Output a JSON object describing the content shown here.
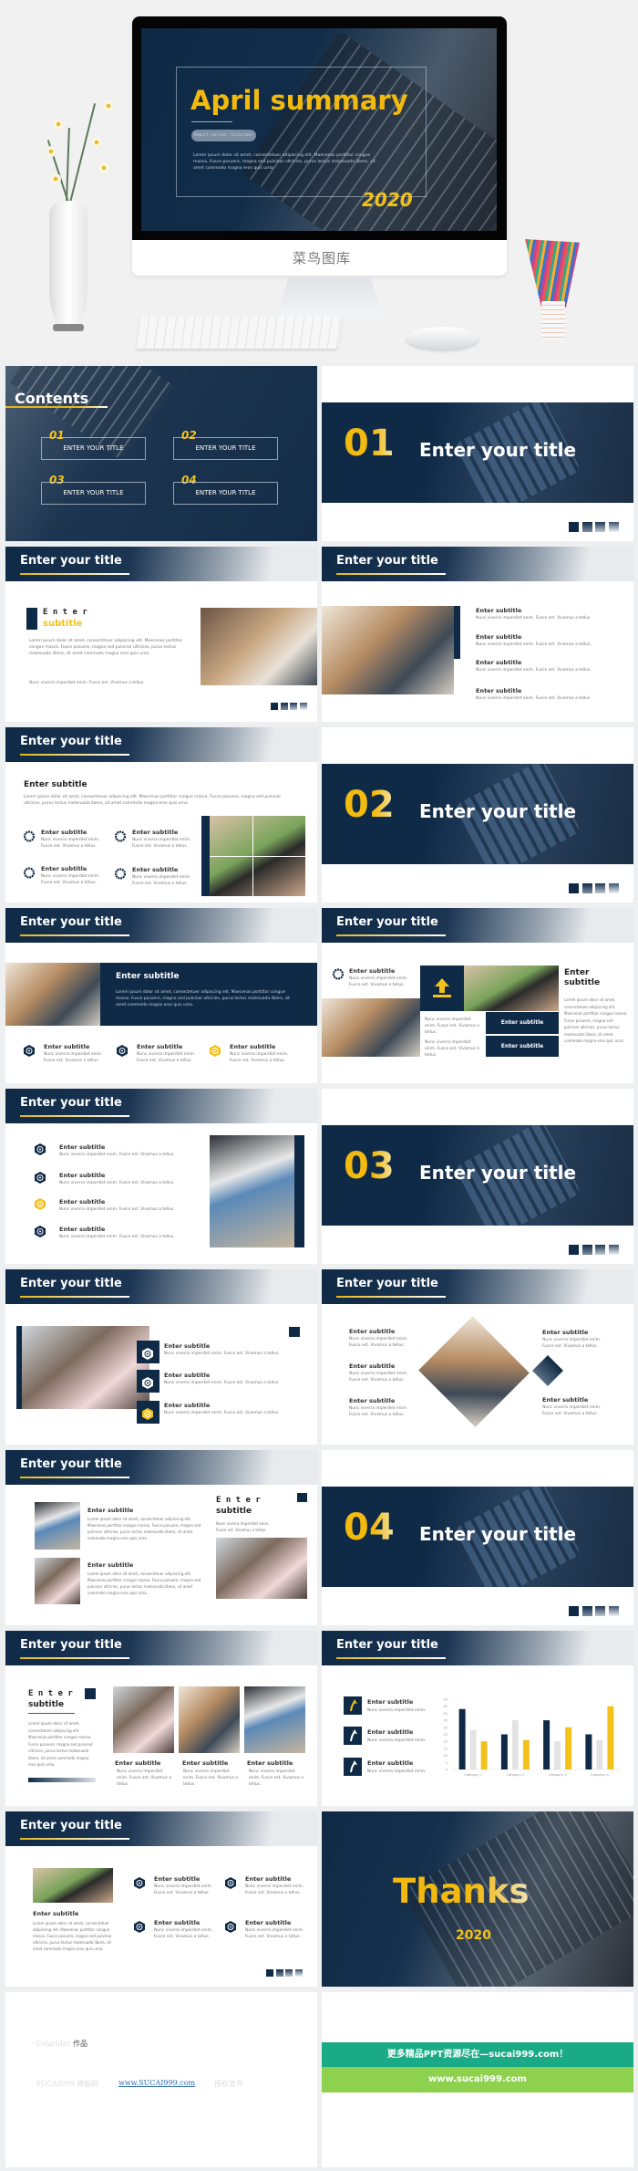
{
  "hero": {
    "title": "April summary",
    "reporter": "Report person: Colarider",
    "paragraph": "Lorem ipsum dolor sit amet, consectetuer adipiscing elit. Maecenas porttitor congue massa. Fusce posuere, magna sed pulvinar ultricies, purus lectus malesuada libero, sit amet commodo magna eros quis urna.",
    "year": "2020",
    "brand": "菜鸟图库"
  },
  "common": {
    "enter_title": "Enter your title",
    "enter_subtitle": "Enter subtitle",
    "enter_spaced": "E n t e r",
    "subtitle_word": "subtitle",
    "enter_word": "Enter",
    "nunc": "Nunc viverra imperdiet enim. Fusce est. Vivamus a tellus.",
    "nunc_short": "Nunc viverra imperdiet enim.",
    "lorem_long": "Lorem ipsum dolor sit amet, consectetuer adipiscing elit. Maecenas porttitor congue massa. Fusce posuere, magna sed pulvinar ultricies, purus lectus malesuada libero, sit amet commodo magna eros quis urna."
  },
  "contents": {
    "title": "Contents",
    "items": [
      {
        "num": "01",
        "label": "ENTER YOUR TITLE"
      },
      {
        "num": "02",
        "label": "ENTER YOUR TITLE"
      },
      {
        "num": "03",
        "label": "ENTER YOUR TITLE"
      },
      {
        "num": "04",
        "label": "ENTER YOUR TITLE"
      }
    ]
  },
  "sections": [
    "01",
    "02",
    "03",
    "04"
  ],
  "chart_data": {
    "type": "bar",
    "categories": [
      "Category 1",
      "Category 2",
      "Category 3",
      "Category 4"
    ],
    "series": [
      {
        "values": [
          43,
          25,
          35,
          25
        ]
      },
      {
        "values": [
          28,
          35,
          20,
          21
        ]
      },
      {
        "values": [
          20,
          21,
          30,
          45
        ]
      }
    ],
    "yticks": [
      0,
      5,
      10,
      15,
      20,
      25,
      30,
      35,
      40,
      45,
      50
    ],
    "ylim": [
      0,
      50
    ],
    "colors": [
      "#0f2a47",
      "#e3e3e3",
      "#f2c21a"
    ],
    "grid": false
  },
  "thanks": {
    "title": "Thanks",
    "year": "2020"
  },
  "credits": {
    "line1_name": "· Colarider",
    "line1_suffix": "作品",
    "line2_name": "· SUCAI999 模板网",
    "line2_link": "www.SUCAI999.com",
    "line2_suffix": "授权发布"
  },
  "promo": {
    "banner": "更多精品PPT资源尽在—sucai999.com！",
    "url": "www.sucai999.com",
    "colors": {
      "teal": "#1aab86",
      "green": "#8ed14f"
    }
  },
  "colors": {
    "navy": "#0f2a47",
    "gold": "#f2c21a"
  }
}
